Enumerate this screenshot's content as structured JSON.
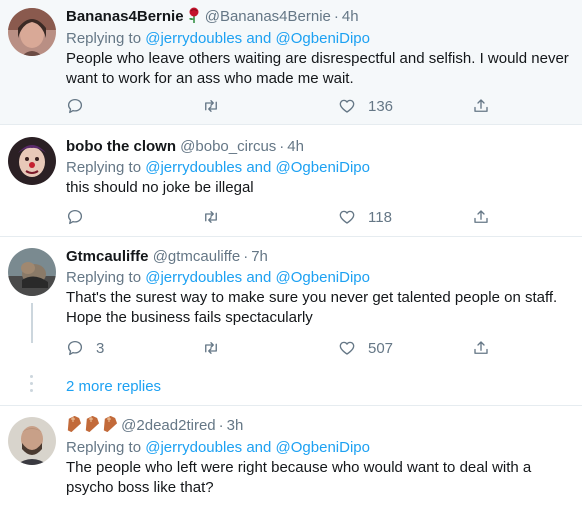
{
  "tweets": [
    {
      "name": "Bananas4Bernie",
      "handle": "@Bananas4Bernie",
      "time": "4h",
      "replying_prefix": "Replying to",
      "replying_targets": "@jerrydoubles and @OgbeniDipo",
      "text": "People who leave others waiting are disrespectful and selfish. I would never want to work for an ass who made me wait.",
      "replies": "",
      "likes": "136",
      "name_icon": "rose-icon"
    },
    {
      "name": "bobo the clown",
      "handle": "@bobo_circus",
      "time": "4h",
      "replying_prefix": "Replying to",
      "replying_targets": "@jerrydoubles and @OgbeniDipo",
      "text": "this should no joke be illegal",
      "replies": "",
      "likes": "118"
    },
    {
      "name": "Gtmcauliffe",
      "handle": "@gtmcauliffe",
      "time": "7h",
      "replying_prefix": "Replying to",
      "replying_targets": "@jerrydoubles and @OgbeniDipo",
      "text": "That's the surest way to make sure you never get talented people on staff. Hope the business fails spectacularly",
      "replies": "3",
      "likes": "507"
    },
    {
      "name_icons": [
        "coffin-icon",
        "coffin-icon",
        "coffin-icon"
      ],
      "handle": "@2dead2tired",
      "time": "3h",
      "replying_prefix": "Replying to",
      "replying_targets": "@jerrydoubles and @OgbeniDipo",
      "text": "The people who left were right because who would want to deal with a psycho boss like that?"
    }
  ],
  "more_replies": "2 more replies",
  "separator": "·",
  "colors": {
    "link": "#1da1f2",
    "muted": "#657786",
    "text": "#14171a",
    "highlight_bg": "#f5f8fa",
    "divider": "#e6ecf0"
  }
}
